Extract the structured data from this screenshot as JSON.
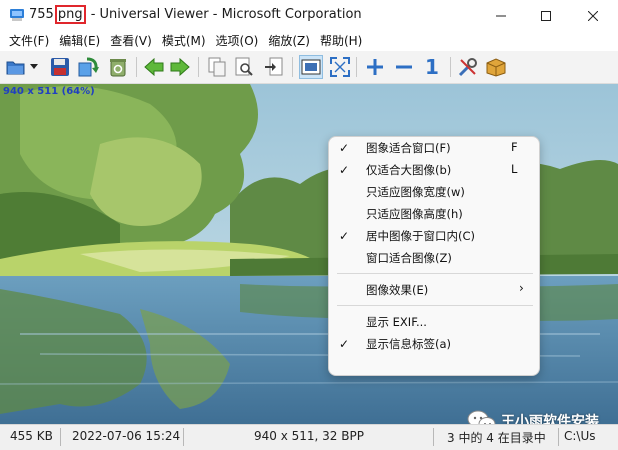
{
  "window": {
    "title_prefix": "755",
    "title_highlight": "png",
    "title_suffix": "- Universal Viewer - Microsoft Corporation"
  },
  "menu": [
    "文件(F)",
    "编辑(E)",
    "查看(V)",
    "模式(M)",
    "选项(O)",
    "缩放(Z)",
    "帮助(H)"
  ],
  "toolbar": {
    "buttons": [
      "open-icon",
      "dropdown-arrow-icon",
      "save-icon",
      "reload-icon",
      "recycle-icon",
      "arrow-left-icon",
      "arrow-right-icon",
      "copy-icon",
      "print-preview-icon",
      "export-icon",
      "fit-window-icon",
      "fullscreen-icon",
      "zoom-in-icon",
      "zoom-out-icon",
      "zoom-original-icon",
      "tools-icon",
      "package-icon"
    ],
    "zoom_original_label": "1"
  },
  "image": {
    "info_label": "940 x 511 (64%)"
  },
  "context_menu": {
    "items": [
      {
        "label": "图象适合窗口(F)",
        "checked": true,
        "key": "F"
      },
      {
        "label": "仅适合大图像(b)",
        "checked": true,
        "key": "L"
      },
      {
        "label": "只适应图像宽度(w)",
        "checked": false,
        "key": ""
      },
      {
        "label": "只适应图像高度(h)",
        "checked": false,
        "key": ""
      },
      {
        "label": "居中图像于窗口内(C)",
        "checked": true,
        "key": ""
      },
      {
        "label": "窗口适合图像(Z)",
        "checked": false,
        "key": ""
      },
      {
        "label": "图像效果(E)",
        "checked": false,
        "key": "",
        "submenu": true
      },
      {
        "label": "显示 EXIF...",
        "checked": false,
        "key": ""
      },
      {
        "label": "显示信息标签(a)",
        "checked": true,
        "key": ""
      }
    ],
    "check_glyph": "✓",
    "submenu_glyph": "›"
  },
  "watermark": {
    "text": "王小雨软件安装"
  },
  "statusbar": {
    "size": "455 KB",
    "date": "2022-07-06 15:24",
    "dimensions": "940 x 511, 32 BPP",
    "position": "3 中的 4 在目录中",
    "path": "C:\\Us"
  },
  "colors": {
    "accent_red": "#e0262c",
    "info_blue": "#2040c0",
    "toolbar_active": "#cce4f7"
  }
}
